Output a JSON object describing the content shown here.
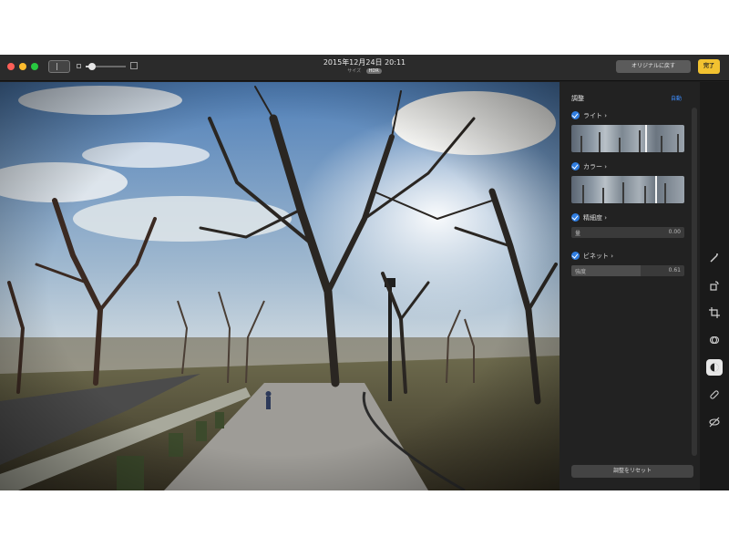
{
  "window": {
    "title_date": "2015年12月24日 20:11",
    "title_sub": "サイズ",
    "title_badge": "HDR",
    "zoom_level": 0.15
  },
  "toolbar": {
    "revert_label": "オリジナルに戻す",
    "done_label": "完了"
  },
  "panel": {
    "title": "調整",
    "auto_label": "自動",
    "sections": [
      {
        "label": "ライト ›",
        "marker": 0.65
      },
      {
        "label": "カラー ›",
        "marker": 0.74
      },
      {
        "label": "精細度 ›",
        "slider_label": "量",
        "slider_value": "0.00",
        "level": 0.0
      },
      {
        "label": "ビネット ›",
        "slider_label": "強度",
        "slider_value": "0.61",
        "level": 0.61
      }
    ],
    "reset_label": "調整をリセット"
  },
  "colors": {
    "accent": "#2f7de1",
    "done": "#f2c230"
  },
  "tools": [
    "magic-wand-icon",
    "rotate-icon",
    "crop-icon",
    "filters-icon",
    "adjust-icon",
    "retouch-icon",
    "red-eye-icon"
  ]
}
